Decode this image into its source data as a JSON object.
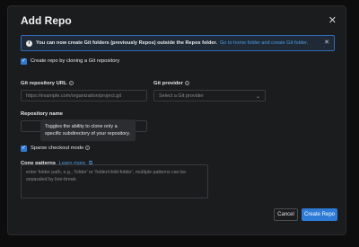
{
  "dialog": {
    "title": "Add Repo",
    "close_icon": "close-icon"
  },
  "banner": {
    "message": "You can now create Git folders (previously Repos) outside the Repos folder.",
    "link": "Go to home folder and create Git folder.",
    "icon": "info-icon"
  },
  "clone_checkbox": {
    "label": "Create repo by cloning a Git repository",
    "checked": true
  },
  "git_repo_url": {
    "label": "Git repository URL",
    "placeholder": "https://example.com/organization/project.git"
  },
  "git_provider": {
    "label": "Git provider",
    "placeholder": "Select a Git provider"
  },
  "repo_name": {
    "label": "Repository name",
    "value": ""
  },
  "tooltip": {
    "text": "Toggles the ability to clone only a specific subdirectory of your repository."
  },
  "sparse_checkout": {
    "label": "Sparse checkout mode",
    "checked": true
  },
  "cone_patterns": {
    "label": "Cone patterns",
    "learn_more": "Learn more",
    "placeholder": "enter folder path, e.g., 'folder' or 'folder/child-folder', multiple patterns can be separated by line-break."
  },
  "buttons": {
    "cancel": "Cancel",
    "create": "Create Repo"
  },
  "colors": {
    "accent": "#2d7bd6",
    "link": "#4d9be0",
    "background": "#1b1c1e"
  }
}
